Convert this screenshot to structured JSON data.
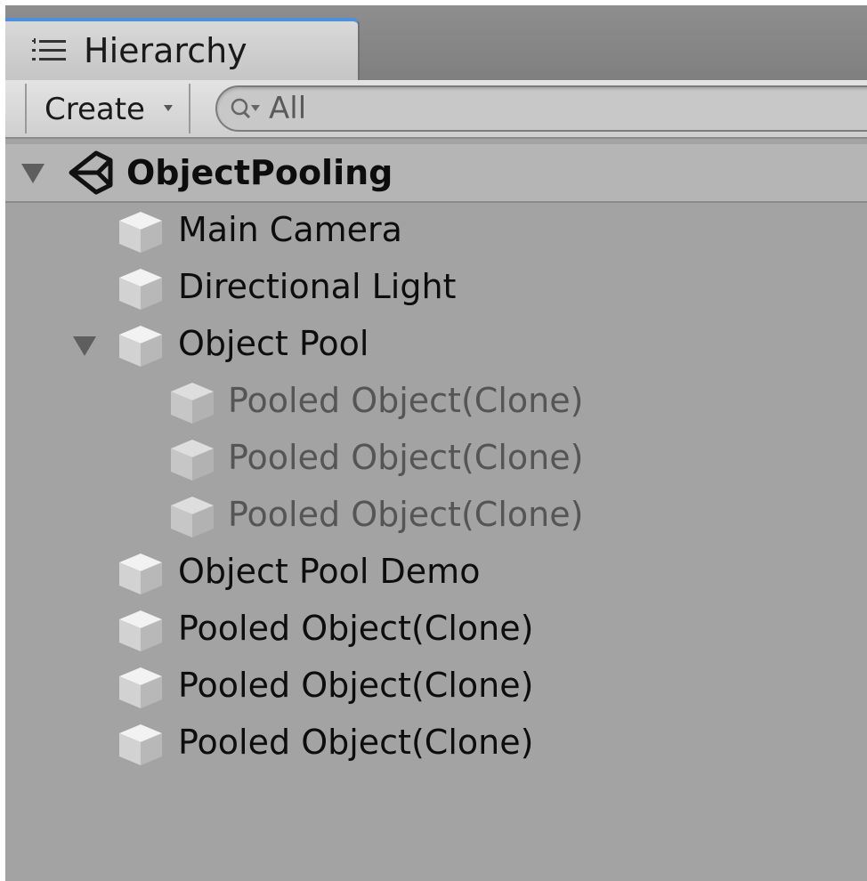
{
  "tab": {
    "title": "Hierarchy",
    "icon": "hierarchy-list-icon"
  },
  "toolbar": {
    "create_label": "Create",
    "search_placeholder": "All"
  },
  "scene": {
    "name": "ObjectPooling",
    "icon": "unity-logo-icon",
    "expanded": true
  },
  "items": [
    {
      "label": "Main Camera",
      "depth": 1,
      "active": true,
      "expandable": false
    },
    {
      "label": "Directional Light",
      "depth": 1,
      "active": true,
      "expandable": false
    },
    {
      "label": "Object Pool",
      "depth": 1,
      "active": true,
      "expandable": true,
      "expanded": true
    },
    {
      "label": "Pooled Object(Clone)",
      "depth": 2,
      "active": false,
      "expandable": false
    },
    {
      "label": "Pooled Object(Clone)",
      "depth": 2,
      "active": false,
      "expandable": false
    },
    {
      "label": "Pooled Object(Clone)",
      "depth": 2,
      "active": false,
      "expandable": false
    },
    {
      "label": "Object Pool Demo",
      "depth": 1,
      "active": true,
      "expandable": false
    },
    {
      "label": "Pooled Object(Clone)",
      "depth": 1,
      "active": true,
      "expandable": false
    },
    {
      "label": "Pooled Object(Clone)",
      "depth": 1,
      "active": true,
      "expandable": false
    },
    {
      "label": "Pooled Object(Clone)",
      "depth": 1,
      "active": true,
      "expandable": false
    }
  ],
  "colors": {
    "panel_background": "#a3a3a3",
    "tab_accent": "#4d91dd",
    "active_text": "#0d0d0d",
    "inactive_text": "#555555"
  }
}
